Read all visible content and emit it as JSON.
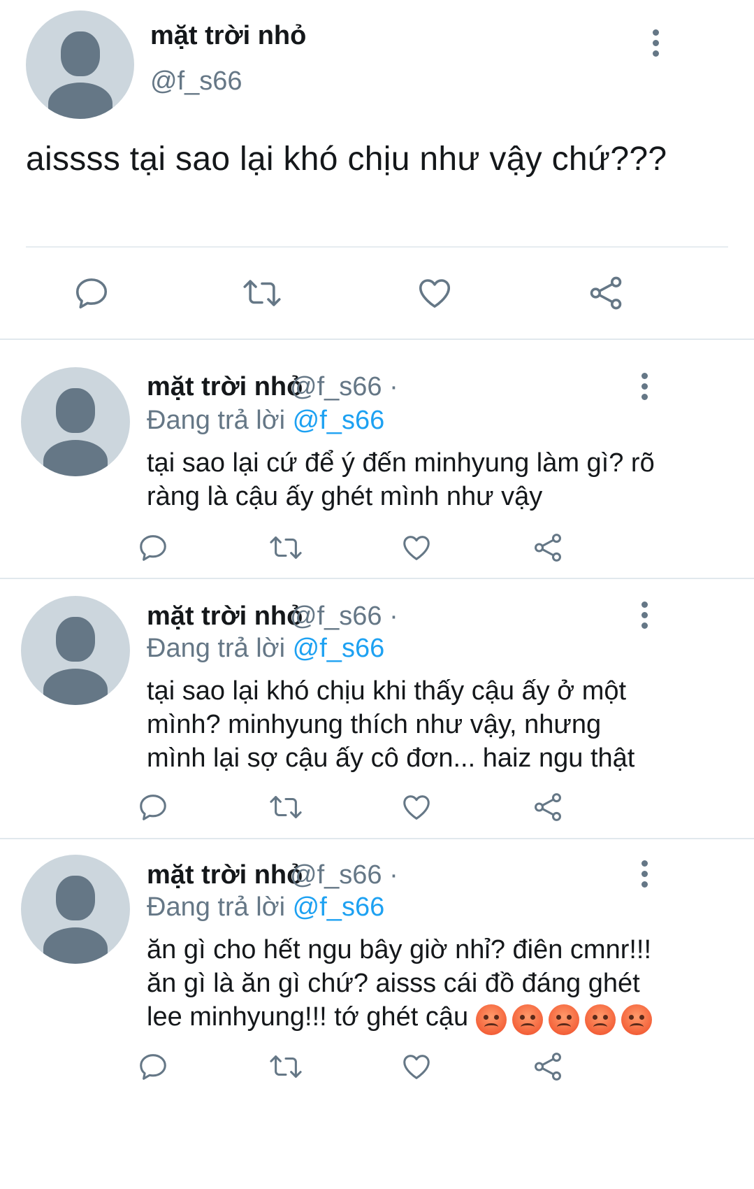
{
  "main_tweet": {
    "name": "mặt trời nhỏ",
    "handle": "@f_s66",
    "text": "aissss tại sao lại khó chịu như vậy chứ???"
  },
  "replies": [
    {
      "name": "mặt trời nhỏ",
      "handle": "@f_s66 ·",
      "replying_prefix": "Đang trả lời ",
      "replying_to": "@f_s66",
      "text_lines": [
        "tại sao lại cứ để ý đến minhyung làm gì? rõ",
        "ràng là cậu ấy ghét mình như vậy"
      ]
    },
    {
      "name": "mặt trời nhỏ",
      "handle": "@f_s66 ·",
      "replying_prefix": "Đang trả lời ",
      "replying_to": "@f_s66",
      "text_lines": [
        "tại sao lại khó chịu khi thấy cậu ấy ở một",
        "mình? minhyung thích như vậy, nhưng",
        "mình lại sợ cậu ấy cô đơn... haiz ngu thật"
      ]
    },
    {
      "name": "mặt trời nhỏ",
      "handle": "@f_s66 ·",
      "replying_prefix": "Đang trả lời ",
      "replying_to": "@f_s66",
      "text_lines": [
        "ăn gì cho hết ngu bây giờ nhỉ? điên cmnr!!!",
        "ăn gì là ăn gì chứ? aisss cái đồ đáng ghét",
        "lee minhyung!!! tớ ghét cậu"
      ],
      "emoji_count": 5
    }
  ],
  "icons": [
    "reply-icon",
    "retweet-icon",
    "like-icon",
    "share-icon",
    "more-icon"
  ],
  "colors": {
    "icon": "#657786",
    "link": "#1da1f2",
    "avatar_bg": "#ccd6dd"
  }
}
